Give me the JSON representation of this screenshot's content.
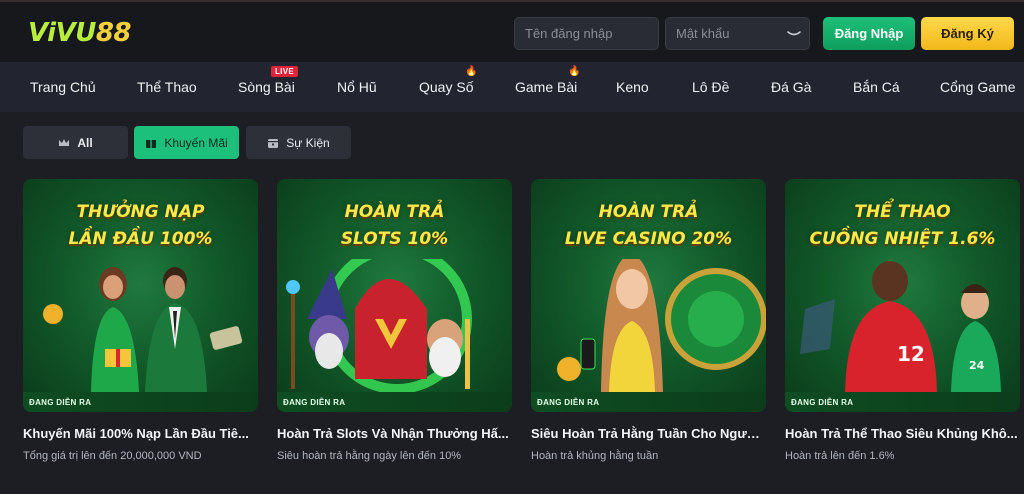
{
  "logo": {
    "part1": "ViVU",
    "part2": "88"
  },
  "auth": {
    "username_placeholder": "Tên đăng nhập",
    "password_placeholder": "Mật khẩu",
    "login_label": "Đăng Nhập",
    "register_label": "Đăng Ký"
  },
  "nav": {
    "items": [
      {
        "label": "Trang Chủ"
      },
      {
        "label": "Thể Thao"
      },
      {
        "label": "Sòng Bài",
        "badge": "LIVE"
      },
      {
        "label": "Nổ Hũ"
      },
      {
        "label": "Quay Số",
        "icon": "fire-icon"
      },
      {
        "label": "Game Bài",
        "icon": "fire-icon"
      },
      {
        "label": "Keno"
      },
      {
        "label": "Lô Đề"
      },
      {
        "label": "Đá Gà"
      },
      {
        "label": "Bắn Cá"
      },
      {
        "label": "Cổng Game"
      }
    ]
  },
  "filters": [
    {
      "label": "All",
      "icon": "crown-icon",
      "active": false
    },
    {
      "label": "Khuyến Mãi",
      "icon": "gift-icon",
      "active": true
    },
    {
      "label": "Sự Kiện",
      "icon": "calendar-icon",
      "active": false
    }
  ],
  "promos": [
    {
      "banner_line1": "THƯỞNG NẠP",
      "banner_line2": "LẦN ĐẦU 100%",
      "status": "ĐANG DIỄN RA",
      "title": "Khuyến Mãi 100% Nạp Lần Đầu Tiê...",
      "subtitle": "Tổng giá trị lên đến 20,000,000 VND"
    },
    {
      "banner_line1": "HOÀN TRẢ",
      "banner_line2": "SLOTS 10%",
      "status": "ĐANG DIỄN RA",
      "title": "Hoàn Trả Slots Và Nhận Thưởng Hấ...",
      "subtitle": "Siêu hoàn trả hằng ngày lên đến 10%"
    },
    {
      "banner_line1": "HOÀN TRẢ",
      "banner_line2": "LIVE CASINO 20%",
      "status": "ĐANG DIỄN RA",
      "title": "Siêu Hoàn Trả Hằng Tuần Cho Ngườ...",
      "subtitle": "Hoàn trả khủng hằng tuần"
    },
    {
      "banner_line1": "THỂ THAO",
      "banner_line2": "CUỒNG NHIỆT 1.6%",
      "status": "ĐANG DIỄN RA",
      "title": "Hoàn Trả Thể Thao Siêu Khủng Khô...",
      "subtitle": "Hoàn trả lên đến 1.6%"
    }
  ],
  "colors": {
    "brand_green": "#1cc07a",
    "brand_yellow": "#ffd84a",
    "live_red": "#e0243a",
    "banner_title": "#ffe94a"
  }
}
